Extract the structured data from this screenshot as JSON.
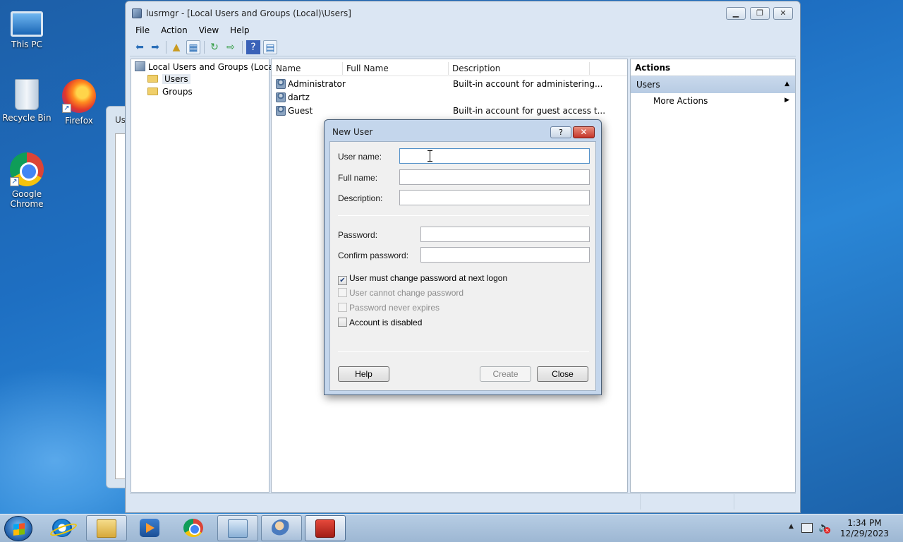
{
  "desktop": {
    "icons": [
      {
        "label": "This PC",
        "icon": "computer-icon"
      },
      {
        "label": "Recycle Bin",
        "icon": "recycle-bin-icon"
      },
      {
        "label": "Firefox",
        "icon": "firefox-icon"
      },
      {
        "label": "Google Chrome",
        "icon": "chrome-icon"
      }
    ],
    "bg_window_label": "Us"
  },
  "window": {
    "title": "lusrmgr - [Local Users and Groups (Local)\\Users]",
    "menu": [
      "File",
      "Action",
      "View",
      "Help"
    ],
    "tree": {
      "root": "Local Users and Groups (Local)",
      "children": [
        "Users",
        "Groups"
      ],
      "selected": "Users"
    },
    "list": {
      "columns": [
        "Name",
        "Full Name",
        "Description"
      ],
      "rows": [
        {
          "name": "Administrator",
          "full_name": "",
          "description": "Built-in account for administering..."
        },
        {
          "name": "dartz",
          "full_name": "",
          "description": ""
        },
        {
          "name": "Guest",
          "full_name": "",
          "description": "Built-in account for guest access t..."
        }
      ]
    },
    "actions": {
      "header": "Actions",
      "section": "Users",
      "items": [
        "More Actions"
      ]
    }
  },
  "dialog": {
    "title": "New User",
    "help_glyph": "?",
    "close_glyph": "✕",
    "fields": {
      "user_name": {
        "label": "User name:",
        "value": ""
      },
      "full_name": {
        "label": "Full name:",
        "value": ""
      },
      "description": {
        "label": "Description:",
        "value": ""
      },
      "password": {
        "label": "Password:",
        "value": ""
      },
      "confirm_password": {
        "label": "Confirm password:",
        "value": ""
      }
    },
    "checkboxes": {
      "must_change": {
        "label": "User must change password at next logon",
        "checked": true,
        "enabled": true
      },
      "cannot_change": {
        "label": "User cannot change password",
        "checked": false,
        "enabled": false
      },
      "never_expires": {
        "label": "Password never expires",
        "checked": false,
        "enabled": false
      },
      "disabled": {
        "label": "Account is disabled",
        "checked": false,
        "enabled": true
      }
    },
    "buttons": {
      "help": "Help",
      "create": "Create",
      "close": "Close"
    }
  },
  "taskbar": {
    "time": "1:34 PM",
    "date": "12/29/2023",
    "apps": [
      "internet-explorer-icon",
      "file-explorer-icon",
      "media-player-icon",
      "chrome-icon",
      "control-panel-icon",
      "users-icon",
      "toolbox-icon"
    ]
  },
  "colors": {
    "accent": "#1e6fc2",
    "dialog_frame": "#c4d6ec",
    "close_red": "#c4352a"
  }
}
